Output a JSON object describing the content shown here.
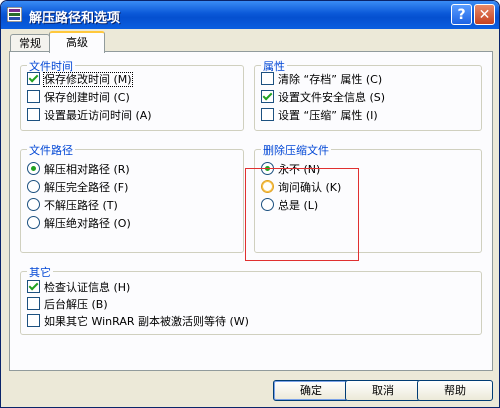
{
  "window": {
    "title": "解压路径和选项"
  },
  "titlebar": {
    "help_label": "?",
    "close_label": "✕"
  },
  "tabs": [
    {
      "label": "常规"
    },
    {
      "label": "高级"
    }
  ],
  "file_time": {
    "title": "文件时间",
    "items": [
      {
        "label": "保存修改时间 (M)",
        "checked": true
      },
      {
        "label": "保存创建时间 (C)",
        "checked": false
      },
      {
        "label": "设置最近访问时间 (A)",
        "checked": false
      }
    ]
  },
  "attributes": {
    "title": "属性",
    "items": [
      {
        "label": "清除 “存档” 属性 (C)",
        "checked": false
      },
      {
        "label": "设置文件安全信息 (S)",
        "checked": true
      },
      {
        "label": "设置 “压缩” 属性 (I)",
        "checked": false
      }
    ]
  },
  "file_paths": {
    "title": "文件路径",
    "items": [
      {
        "label": "解压相对路径 (R)",
        "selected": true
      },
      {
        "label": "解压完全路径 (F)",
        "selected": false
      },
      {
        "label": "不解压路径 (T)",
        "selected": false
      },
      {
        "label": "解压绝对路径 (O)",
        "selected": false
      }
    ]
  },
  "delete_archive": {
    "title": "删除压缩文件",
    "items": [
      {
        "label": "永不 (N)",
        "selected": true
      },
      {
        "label": "询问确认 (K)",
        "selected": false
      },
      {
        "label": "总是 (L)",
        "selected": false
      }
    ]
  },
  "other": {
    "title": "其它",
    "items": [
      {
        "label": "检查认证信息 (H)",
        "checked": true
      },
      {
        "label": "后台解压 (B)",
        "checked": false
      },
      {
        "label": "如果其它 WinRAR 副本被激活则等待 (W)",
        "checked": false
      }
    ]
  },
  "buttons": {
    "ok": "确定",
    "cancel": "取消",
    "help": "帮助"
  },
  "colors": {
    "titlebar": "#0a58d8",
    "group_title": "#0046d5",
    "check_mark": "#21a121",
    "highlight_box": "#e03030"
  }
}
